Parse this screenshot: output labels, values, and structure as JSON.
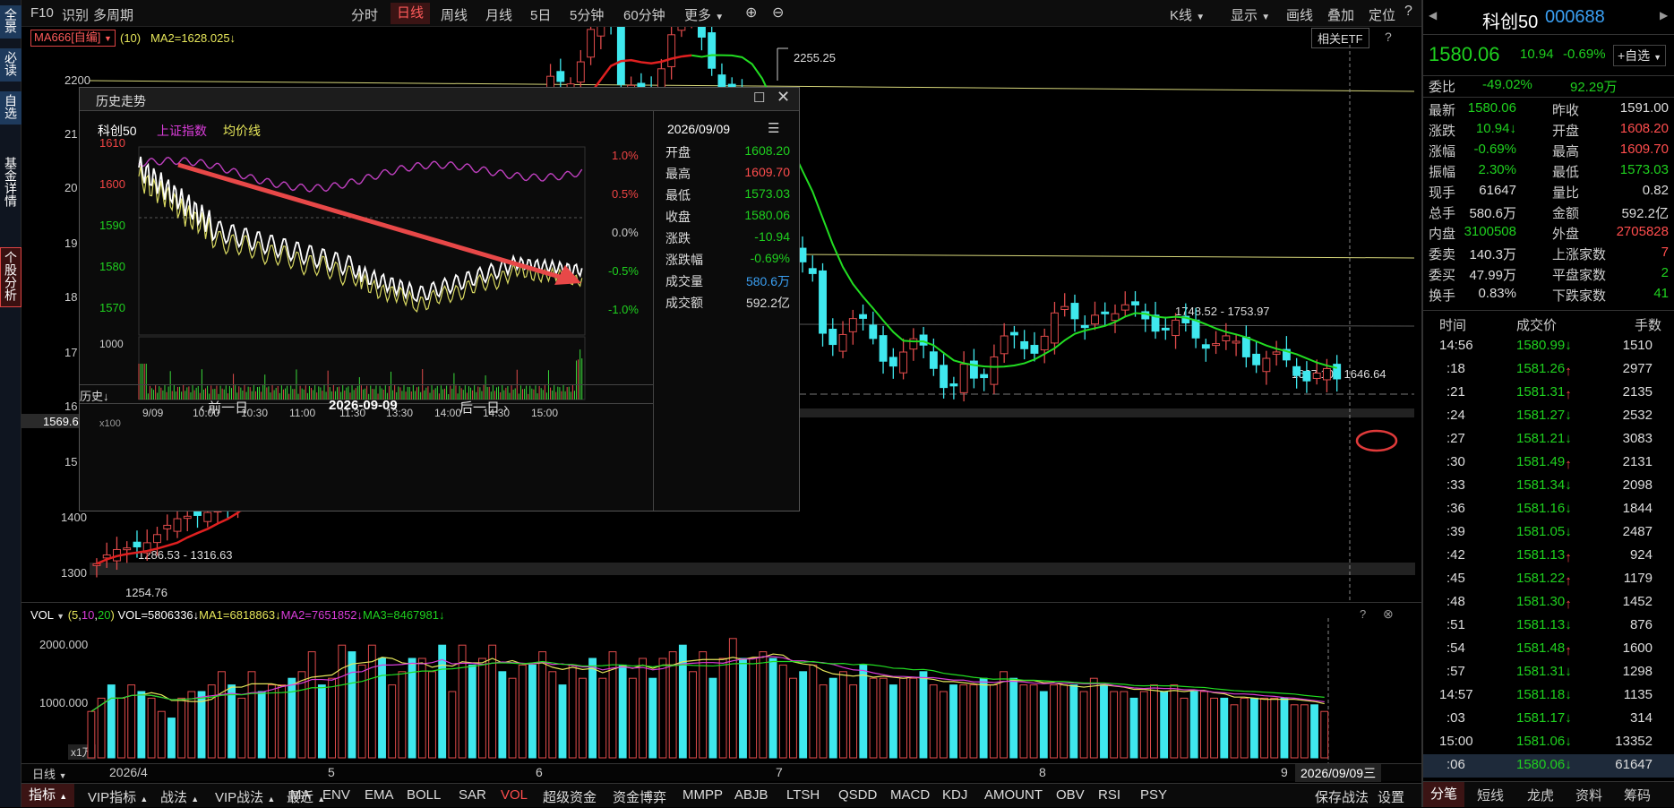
{
  "left_sidebar": [
    {
      "label": "全景"
    },
    {
      "label": "必读"
    },
    {
      "label": "自选"
    },
    {
      "label": "基金详情"
    },
    {
      "label": "个股分析"
    }
  ],
  "toolbar": {
    "f10": "F10",
    "identify": "识别",
    "multi_period": "多周期",
    "periods": [
      "分时",
      "日线",
      "周线",
      "月线",
      "5日",
      "5分钟",
      "60分钟",
      "更多"
    ],
    "active_period": "日线",
    "right": [
      "K线",
      "显示",
      "画线",
      "叠加",
      "定位"
    ]
  },
  "indicator_bar": {
    "ma_name": "MA666[自编]",
    "ma_param": "(10)",
    "ma2": "MA2=1628.025↓",
    "etf_button": "相关ETF"
  },
  "price_axis": {
    "labels": [
      "2200",
      "21",
      "20",
      "19",
      "18",
      "17",
      "16",
      "15",
      "1400",
      "1300"
    ],
    "cursor_price": "1569.6"
  },
  "annotations": {
    "high": "2255.25",
    "range1": "1748.52 - 1753.97",
    "range2": "1637.10 - 1646.64",
    "low1": "1286.53 - 1316.63",
    "low2": "1254.76"
  },
  "volume": {
    "header_name": "VOL",
    "header_params_prefix": "(",
    "header_p1": "5",
    "header_p2": "10",
    "header_p3": "20",
    "header_params_suffix": ")",
    "vol": "VOL=5806336↓",
    "ma1": "MA1=6818863↓",
    "ma2": "MA2=7651852↓",
    "ma3": "MA3=8467981↓",
    "axis": [
      "2000.000",
      "1000.000"
    ],
    "unit": "x1万",
    "values": [
      7,
      9,
      11,
      9,
      11,
      10,
      9,
      7,
      6,
      9,
      10,
      10,
      11,
      13,
      11,
      9,
      13,
      10,
      11,
      11,
      12,
      13,
      16,
      11,
      12,
      17,
      16,
      14,
      17,
      15,
      11,
      13,
      15,
      15,
      13,
      17,
      10,
      17,
      14,
      15,
      17,
      13,
      12,
      14,
      14,
      16,
      13,
      11,
      14,
      12,
      15,
      12,
      16,
      14,
      12,
      15,
      12,
      15,
      16,
      17,
      13,
      16,
      12,
      15,
      18,
      15,
      15,
      16,
      15,
      14,
      12,
      13,
      14,
      11,
      12,
      13,
      11,
      14,
      12,
      12,
      11,
      12,
      12,
      13,
      11,
      10,
      11,
      11,
      11,
      12,
      11,
      13,
      12,
      11,
      11,
      10,
      11,
      11,
      11,
      10,
      12,
      11,
      10,
      10,
      9,
      10,
      11,
      10,
      11,
      9,
      10,
      10,
      9,
      9,
      8,
      9,
      9,
      9,
      9,
      9,
      8,
      8,
      8,
      7
    ]
  },
  "date_bar": {
    "mode": "日线",
    "dates": [
      "2026/4",
      "5",
      "6",
      "7",
      "8",
      "9"
    ],
    "cursor_date": "2026/09/09三"
  },
  "bottom_bar": {
    "left": [
      "指标",
      "VIP指标",
      "战法",
      "VIP战法",
      "最近"
    ],
    "indicators": [
      "MA",
      "ENV",
      "EMA",
      "BOLL",
      "SAR",
      "VOL",
      "超级资金",
      "资金博弈",
      "MMPP",
      "ABJB",
      "LTSH",
      "QSDD",
      "MACD",
      "KDJ",
      "AMOUNT",
      "OBV",
      "RSI",
      "PSY"
    ],
    "active_indicator": "VOL",
    "right": [
      "保存战法",
      "设置"
    ]
  },
  "popup": {
    "title": "历史走势",
    "legend": [
      "科创50",
      "上证指数",
      "均价线"
    ],
    "date_label": "2026/09/09",
    "rows": [
      {
        "k": "开盘",
        "v": "1608.20"
      },
      {
        "k": "最高",
        "v": "1609.70"
      },
      {
        "k": "最低",
        "v": "1573.03"
      },
      {
        "k": "收盘",
        "v": "1580.06"
      },
      {
        "k": "涨跌",
        "v": "-10.94"
      },
      {
        "k": "涨跌幅",
        "v": "-0.69%"
      },
      {
        "k": "成交量",
        "v": "580.6万"
      },
      {
        "k": "成交额",
        "v": "592.2亿"
      }
    ],
    "y_left": [
      "1610",
      "1600",
      "1590",
      "1580",
      "1570"
    ],
    "y_right": [
      "1.0%",
      "0.5%",
      "0.0%",
      "-0.5%",
      "-1.0%"
    ],
    "vol_axis": "1000",
    "vol_unit": "x100",
    "x_axis": [
      "9/09",
      "10:00",
      "10:30",
      "11:00",
      "11:30",
      "13:30",
      "14:00",
      "14:30",
      "15:00"
    ],
    "history_btn": "历史",
    "prev_day": "前一日",
    "next_day": "后一日",
    "current_date": "2026-09-09"
  },
  "quote": {
    "name": "科创50",
    "code": "000688",
    "price": "1580.06",
    "change": "10.94",
    "pct": "-0.69%",
    "watch_btn": "+自选",
    "weibi_label": "委比",
    "weibi": "-49.02%",
    "weicha": "92.29万",
    "stats": [
      [
        "最新",
        "1580.06",
        "昨收",
        "1591.00"
      ],
      [
        "涨跌",
        "10.94↓",
        "开盘",
        "1608.20"
      ],
      [
        "涨幅",
        "-0.69%",
        "最高",
        "1609.70"
      ],
      [
        "振幅",
        "2.30%",
        "最低",
        "1573.03"
      ],
      [
        "现手",
        "61647",
        "量比",
        "0.82"
      ],
      [
        "总手",
        "580.6万",
        "金额",
        "592.2亿"
      ],
      [
        "内盘",
        "3100508",
        "外盘",
        "2705828"
      ],
      [
        "委卖",
        "140.3万",
        "上涨家数",
        "7"
      ],
      [
        "委买",
        "47.99万",
        "平盘家数",
        "2"
      ],
      [
        "换手",
        "0.83%",
        "下跌家数",
        "41"
      ]
    ],
    "trades_header": [
      "时间",
      "成交价",
      "手数"
    ],
    "trades": [
      [
        "14:56",
        "1580.99↓",
        "1510"
      ],
      [
        ":18",
        "1581.26↑",
        "2977"
      ],
      [
        ":21",
        "1581.31↑",
        "2135"
      ],
      [
        ":24",
        "1581.27↓",
        "2532"
      ],
      [
        ":27",
        "1581.21↓",
        "3083"
      ],
      [
        ":30",
        "1581.49↑",
        "2131"
      ],
      [
        ":33",
        "1581.34↓",
        "2098"
      ],
      [
        ":36",
        "1581.16↓",
        "1844"
      ],
      [
        ":39",
        "1581.05↓",
        "2487"
      ],
      [
        ":42",
        "1581.13↑",
        "924"
      ],
      [
        ":45",
        "1581.22↑",
        "1179"
      ],
      [
        ":48",
        "1581.30↑",
        "1452"
      ],
      [
        ":51",
        "1581.13↓",
        "876"
      ],
      [
        ":54",
        "1581.48↑",
        "1600"
      ],
      [
        ":57",
        "1581.31↓",
        "1298"
      ],
      [
        "14:57",
        "1581.18↓",
        "1135"
      ],
      [
        ":03",
        "1581.17↓",
        "314"
      ],
      [
        "15:00",
        "1581.06↓",
        "13352"
      ],
      [
        ":06",
        "1580.06↓",
        "61647"
      ]
    ],
    "tabs": [
      "分笔",
      "短线",
      "龙虎",
      "资料",
      "筹码"
    ]
  }
}
